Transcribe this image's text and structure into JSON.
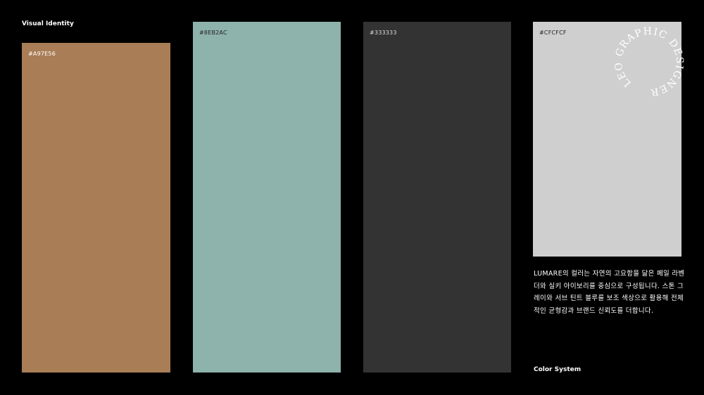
{
  "header": {
    "title": "Visual Identity"
  },
  "footer": {
    "title": "Color System"
  },
  "swatches": [
    {
      "hex": "#A97E56",
      "color": "#A97E56",
      "label_color": "#ffffff"
    },
    {
      "hex": "#8EB2AC",
      "color": "#8EB2AC",
      "label_color": "#222222"
    },
    {
      "hex": "#333333",
      "color": "#333333",
      "label_color": "#dddddd"
    },
    {
      "hex": "#CFCFCF",
      "color": "#CFCFCF",
      "label_color": "#222222"
    }
  ],
  "logo": {
    "text": "LEO GRAPHIC DESIGNER"
  },
  "description": "LUMARE의 컬러는 자연의 고요함을 닮은 페일 라벤더와 실키 아이보리를 중심으로 구성됩니다. 스톤 그레이와 서브 틴트 블루를 보조 색상으로 활용해 전체적인 균형감과 브랜드 신뢰도를 더합니다."
}
